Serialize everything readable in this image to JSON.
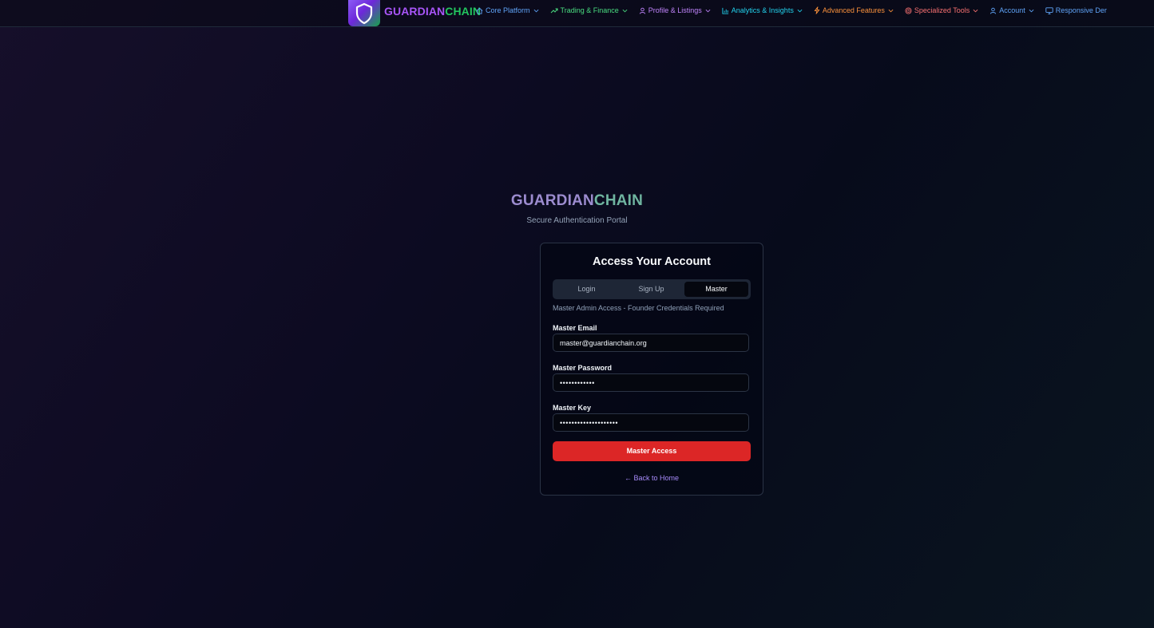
{
  "brand": {
    "part1": "GUARDIAN",
    "part2": "CHAIN"
  },
  "nav": {
    "items": [
      {
        "label": "Core Platform",
        "icon": "home-icon",
        "color": "#60a5fa"
      },
      {
        "label": "Trading & Finance",
        "icon": "trending-up-icon",
        "color": "#4ade80"
      },
      {
        "label": "Profile & Listings",
        "icon": "user-icon",
        "color": "#c084fc"
      },
      {
        "label": "Analytics & Insights",
        "icon": "bar-chart-icon",
        "color": "#22d3ee"
      },
      {
        "label": "Advanced Features",
        "icon": "lightning-icon",
        "color": "#fb923c"
      },
      {
        "label": "Specialized Tools",
        "icon": "target-icon",
        "color": "#f87171"
      },
      {
        "label": "Account",
        "icon": "user-icon",
        "color": "#60a5fa"
      },
      {
        "label": "Responsive Der",
        "icon": "monitor-icon",
        "color": "#60a5fa"
      }
    ]
  },
  "hero": {
    "title_part1": "GUARDIAN",
    "title_part2": "CHAIN",
    "subtitle": "Secure Authentication Portal"
  },
  "card": {
    "title": "Access Your Account",
    "tabs": [
      "Login",
      "Sign Up",
      "Master"
    ],
    "active_tab": "Master",
    "hint": "Master Admin Access - Founder Credentials Required",
    "email_label": "Master Email",
    "email_value": "master@guardianchain.org",
    "password_label": "Master Password",
    "password_value": "••••••••••••",
    "key_label": "Master Key",
    "key_value": "••••••••••••••••••••",
    "submit_label": "Master Access",
    "back_link": "← Back to Home"
  },
  "colors": {
    "accent_purple": "#a855f7",
    "accent_green": "#22c55e",
    "submit_red": "#dc2626",
    "link_purple": "#a78bfa"
  }
}
